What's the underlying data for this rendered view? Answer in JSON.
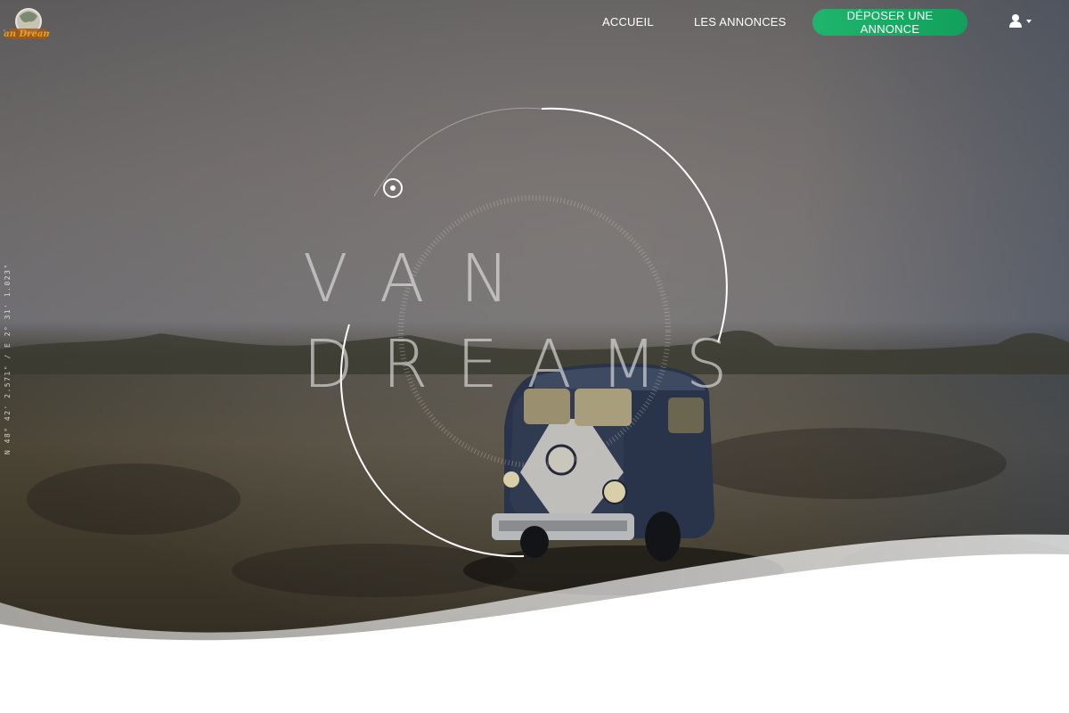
{
  "brand": {
    "logo_text": "Van Dreams",
    "accent_color": "#1fb56c"
  },
  "nav": {
    "items": [
      {
        "label": "ACCUEIL"
      },
      {
        "label": "LES ANNONCES"
      }
    ],
    "cta_label": "DÉPOSER UNE ANNONCE",
    "user_icon": "user-icon"
  },
  "hero": {
    "title_line1": "VAN",
    "title_line2": "DREAMS",
    "coordinates": "N 48° 42' 2.571\" / E 2° 31' 1.023\""
  }
}
